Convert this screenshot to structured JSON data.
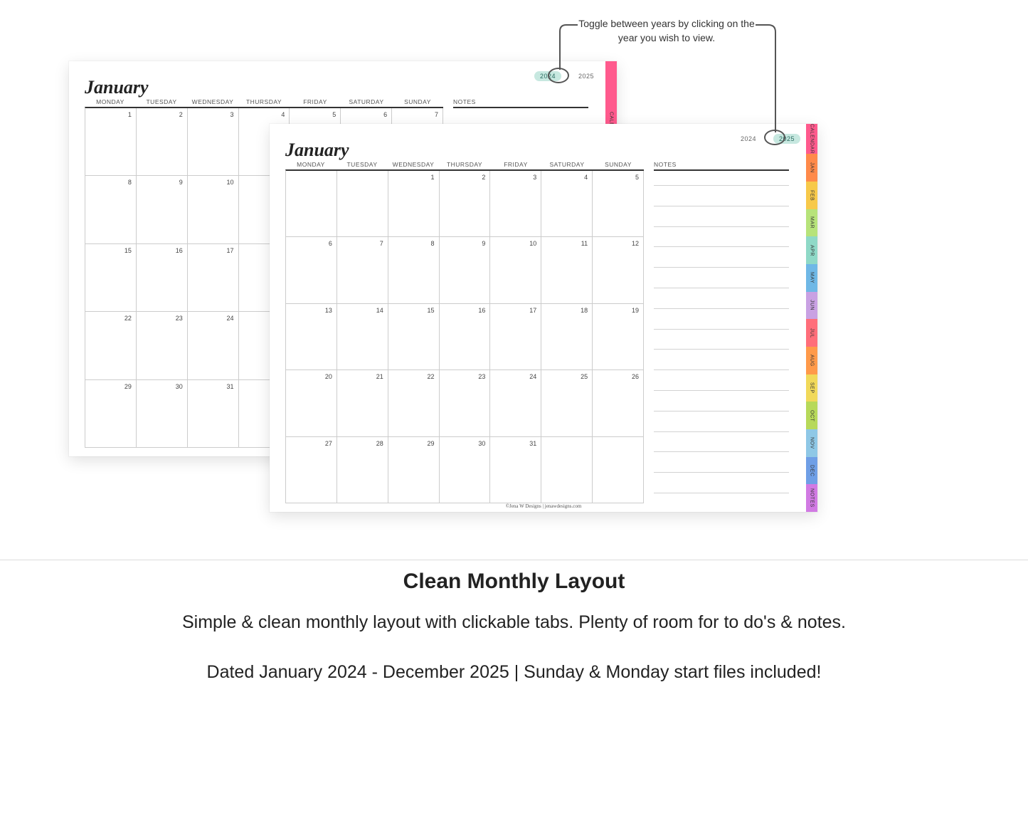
{
  "callout": "Toggle between years by clicking on the year you wish to view.",
  "month_title": "January",
  "years": {
    "y2024": "2024",
    "y2025": "2025"
  },
  "day_headers": [
    "MONDAY",
    "TUESDAY",
    "WEDNESDAY",
    "THURSDAY",
    "FRIDAY",
    "SATURDAY",
    "SUNDAY"
  ],
  "notes_label": "NOTES",
  "back": {
    "active_year": "2024",
    "rows": 5,
    "offset": 0,
    "last_day": 31,
    "note_lines": 1,
    "tabs": [
      {
        "label": "CALENDAR",
        "color": "#ff5a8d"
      },
      {
        "label": "JAN",
        "color": "#ff8a4a"
      },
      {
        "label": "",
        "color": "#f7c94a"
      }
    ]
  },
  "front": {
    "active_year": "2025",
    "rows": 5,
    "offset": 2,
    "last_day": 31,
    "note_lines": 16,
    "tabs": [
      {
        "label": "CALENDAR",
        "color": "#ff5a8d"
      },
      {
        "label": "JAN",
        "color": "#ff8a4a"
      },
      {
        "label": "FEB",
        "color": "#f7c94a"
      },
      {
        "label": "MAR",
        "color": "#b7e37a"
      },
      {
        "label": "APR",
        "color": "#8fd9c7"
      },
      {
        "label": "MAY",
        "color": "#6fb8e6"
      },
      {
        "label": "JUN",
        "color": "#c9a1e3"
      },
      {
        "label": "JUL",
        "color": "#ff6e7a"
      },
      {
        "label": "AUG",
        "color": "#ff9a4a"
      },
      {
        "label": "SEP",
        "color": "#f1d95a"
      },
      {
        "label": "OCT",
        "color": "#b7d95a"
      },
      {
        "label": "NOV",
        "color": "#8fc8e6"
      },
      {
        "label": "DEC",
        "color": "#6f9fe6"
      },
      {
        "label": "NOTES",
        "color": "#d17ae3"
      }
    ],
    "footer": "©Jena W Designs | jenawdesigns.com"
  },
  "promo": {
    "heading": "Clean Monthly Layout",
    "line1": "Simple & clean monthly layout with clickable tabs. Plenty of room for to do's & notes.",
    "line2": "Dated January 2024 - December 2025 | Sunday & Monday start files included!"
  }
}
